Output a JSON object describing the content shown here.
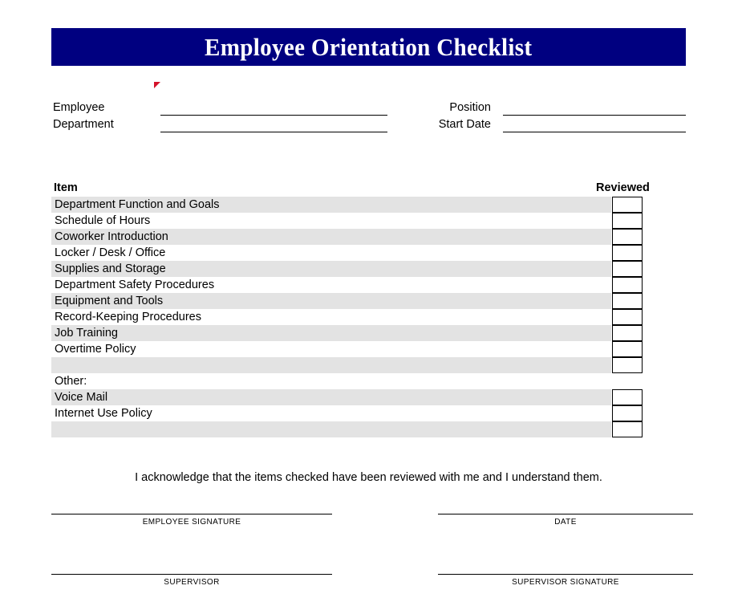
{
  "document": {
    "title": "Employee Orientation Checklist",
    "banner_color": "#000080",
    "banner_text_color": "#ffffff",
    "shaded_row_color": "#e3e3e3",
    "mark_color": "#d4122a"
  },
  "header_fields": {
    "employee": {
      "label": "Employee",
      "value": ""
    },
    "department": {
      "label": "Department",
      "value": ""
    },
    "position": {
      "label": "Position",
      "value": ""
    },
    "start_date": {
      "label": "Start Date",
      "value": ""
    }
  },
  "checklist": {
    "columns": {
      "item": "Item",
      "reviewed": "Reviewed"
    },
    "rows": [
      {
        "label": "Department Function and Goals",
        "shaded": true,
        "has_box": true,
        "checked": false
      },
      {
        "label": "Schedule of Hours",
        "shaded": false,
        "has_box": true,
        "checked": false
      },
      {
        "label": "Coworker Introduction",
        "shaded": true,
        "has_box": true,
        "checked": false
      },
      {
        "label": "Locker / Desk / Office",
        "shaded": false,
        "has_box": true,
        "checked": false
      },
      {
        "label": "Supplies and Storage",
        "shaded": true,
        "has_box": true,
        "checked": false
      },
      {
        "label": "Department Safety Procedures",
        "shaded": false,
        "has_box": true,
        "checked": false
      },
      {
        "label": "Equipment and Tools",
        "shaded": true,
        "has_box": true,
        "checked": false
      },
      {
        "label": "Record-Keeping Procedures",
        "shaded": false,
        "has_box": true,
        "checked": false
      },
      {
        "label": "Job Training",
        "shaded": true,
        "has_box": true,
        "checked": false
      },
      {
        "label": "Overtime Policy",
        "shaded": false,
        "has_box": true,
        "checked": false
      },
      {
        "label": "",
        "shaded": true,
        "has_box": true,
        "checked": false
      },
      {
        "label": "Other:",
        "shaded": false,
        "has_box": false,
        "checked": false
      },
      {
        "label": "Voice Mail",
        "shaded": true,
        "has_box": true,
        "checked": false
      },
      {
        "label": "Internet Use Policy",
        "shaded": false,
        "has_box": true,
        "checked": false
      },
      {
        "label": "",
        "shaded": true,
        "has_box": true,
        "checked": false
      }
    ]
  },
  "acknowledgment": {
    "text": "I acknowledge that the items checked have been reviewed with me and I understand them."
  },
  "signatures": {
    "employee_signature": {
      "caption": "EMPLOYEE SIGNATURE",
      "value": ""
    },
    "date": {
      "caption": "DATE",
      "value": ""
    },
    "supervisor": {
      "caption": "SUPERVISOR",
      "value": ""
    },
    "supervisor_signature": {
      "caption": "SUPERVISOR SIGNATURE",
      "value": ""
    }
  }
}
